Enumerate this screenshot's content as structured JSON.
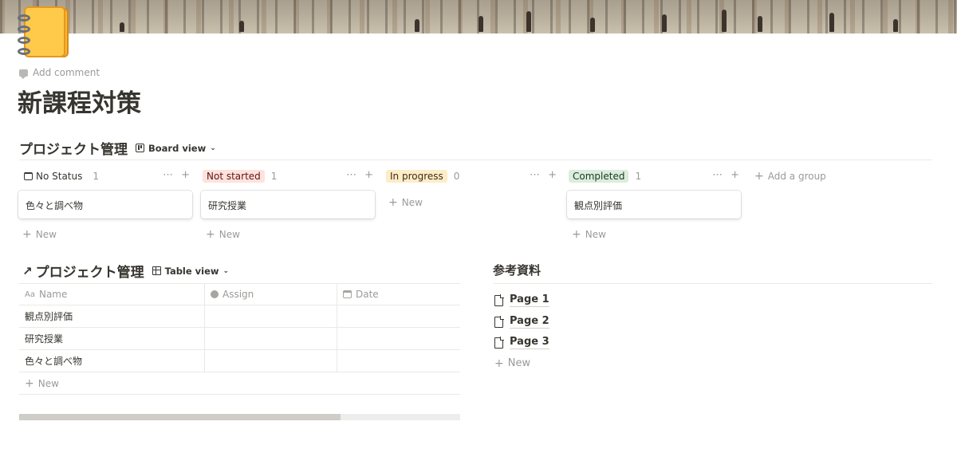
{
  "add_comment": "Add comment",
  "page_title": "新課程対策",
  "board": {
    "title": "プロジェクト管理",
    "view_label": "Board view",
    "groups": [
      {
        "label": "No Status",
        "count": "1",
        "color": "transparent",
        "card": "色々と調べ物"
      },
      {
        "label": "Not started",
        "count": "1",
        "color": "#ffe2dd",
        "card": "研究授業"
      },
      {
        "label": "In progress",
        "count": "0",
        "color": "#fdecc8",
        "card": ""
      },
      {
        "label": "Completed",
        "count": "1",
        "color": "#dbeddb",
        "card": "観点別評価"
      }
    ],
    "new_label": "New",
    "add_group_label": "Add a group"
  },
  "table": {
    "title": "プロジェクト管理",
    "view_label": "Table view",
    "columns": [
      "Name",
      "Assign",
      "Date"
    ],
    "rows": [
      {
        "name": "観点別評価",
        "assign": "",
        "date": ""
      },
      {
        "name": "研究授業",
        "assign": "",
        "date": ""
      },
      {
        "name": "色々と調べ物",
        "assign": "",
        "date": ""
      }
    ],
    "new_label": "New"
  },
  "references": {
    "title": "参考資料",
    "pages": [
      "Page 1",
      "Page 2",
      "Page 3"
    ],
    "new_label": "New"
  }
}
